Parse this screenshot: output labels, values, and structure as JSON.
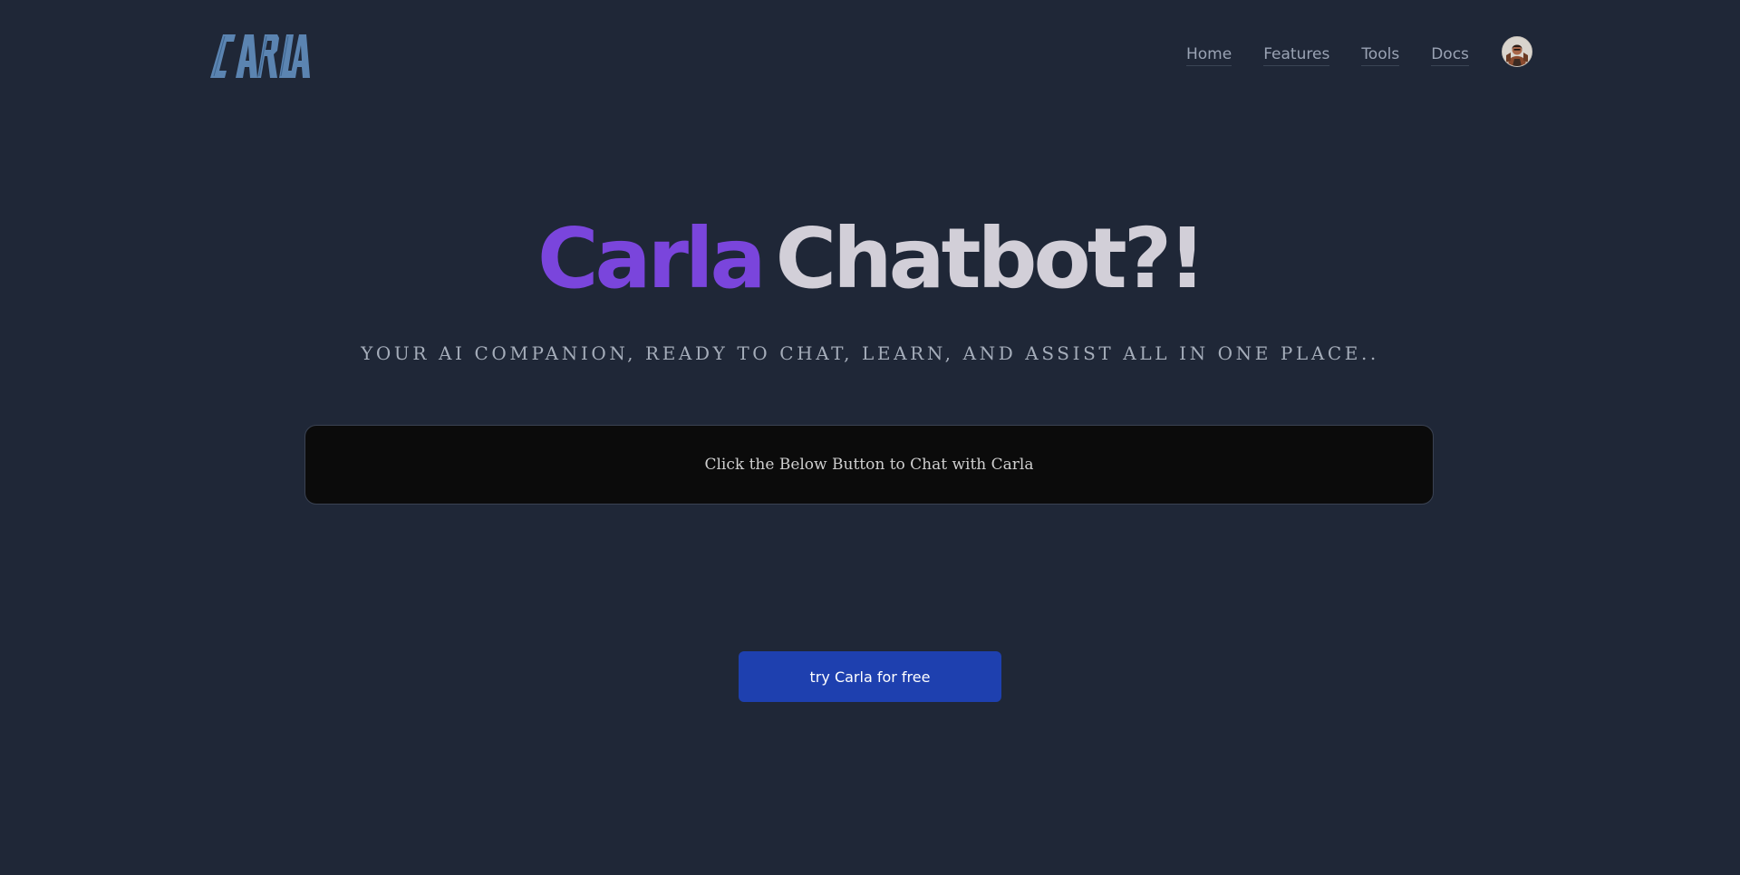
{
  "header": {
    "logo_text": "CARLA",
    "nav": [
      {
        "label": "Home"
      },
      {
        "label": "Features"
      },
      {
        "label": "Tools"
      },
      {
        "label": "Docs"
      }
    ],
    "avatar_icon": "user-avatar-icon"
  },
  "hero": {
    "title_part1": "Carla",
    "title_part2": "Chatbot?!",
    "tagline": "YOUR AI COMPANION, READY TO CHAT, LEARN, AND ASSIST ALL IN ONE PLACE..",
    "info_text": "Click the Below Button to Chat with Carla",
    "cta_label": "try Carla for free"
  },
  "colors": {
    "background": "#1f2737",
    "accent_purple": "#7a45dc",
    "title_light": "#d2cfd8",
    "logo_blue": "#5b84b1",
    "cta_blue": "#1e40af",
    "info_box_bg": "#0b0b0b"
  }
}
